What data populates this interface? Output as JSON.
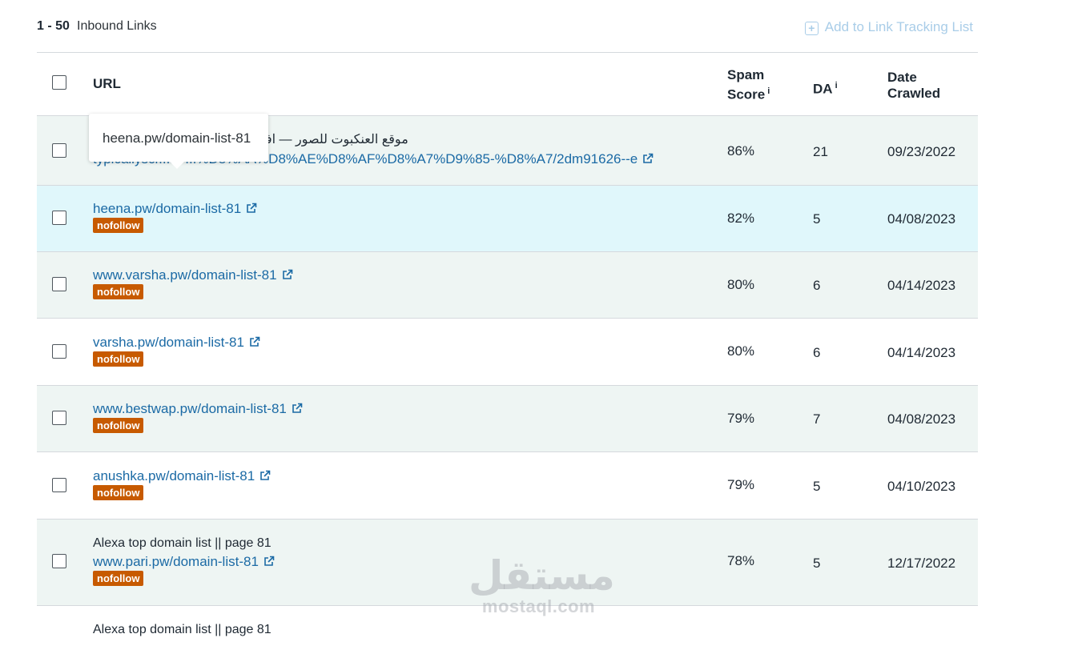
{
  "header": {
    "range": "1 - 50",
    "title": "Inbound Links",
    "add_to_tracking_label": "Add to Link Tracking List"
  },
  "table": {
    "columns": {
      "url": "URL",
      "spam_score_line1": "Spam",
      "spam_score_line2": "Score",
      "da": "DA",
      "info_glyph": "i",
      "date_line1": "Date",
      "date_line2": "Crawled"
    },
    "rows": [
      {
        "title": "موقع العنكبوت للصور — افضل",
        "url": "typicallyscr...m/...%D8%AA%D8%AE%D8%AF%D8%A7%D9%85-%D8%A7/2dm91626--e",
        "spam": "86%",
        "da": "21",
        "date": "09/23/2022"
      },
      {
        "url": "heena.pw/domain-list-81",
        "badge": "nofollow",
        "spam": "82%",
        "da": "5",
        "date": "04/08/2023"
      },
      {
        "url": "www.varsha.pw/domain-list-81",
        "badge": "nofollow",
        "spam": "80%",
        "da": "6",
        "date": "04/14/2023"
      },
      {
        "url": "varsha.pw/domain-list-81",
        "badge": "nofollow",
        "spam": "80%",
        "da": "6",
        "date": "04/14/2023"
      },
      {
        "url": "www.bestwap.pw/domain-list-81",
        "badge": "nofollow",
        "spam": "79%",
        "da": "7",
        "date": "04/08/2023"
      },
      {
        "url": "anushka.pw/domain-list-81",
        "badge": "nofollow",
        "spam": "79%",
        "da": "5",
        "date": "04/10/2023"
      },
      {
        "title": "Alexa top domain list || page 81",
        "url": "www.pari.pw/domain-list-81",
        "badge": "nofollow",
        "spam": "78%",
        "da": "5",
        "date": "12/17/2022"
      },
      {
        "title": "Alexa top domain list || page 81"
      }
    ]
  },
  "tooltip": {
    "text": "heena.pw/domain-list-81"
  },
  "watermark": {
    "big": "مستقل",
    "small": "mostaql.com"
  },
  "colors": {
    "link": "#1b6aa5",
    "badge": "#c75a00",
    "row_alt": "#eef5f3",
    "row_highlight": "#e0f7fb"
  }
}
